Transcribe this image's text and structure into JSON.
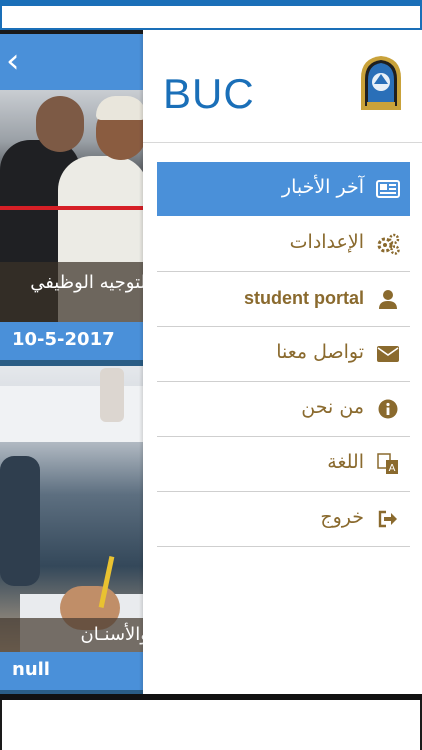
{
  "drawer": {
    "brand": "BUC",
    "menu": [
      {
        "label": "آخر الأخبار",
        "icon": "newspaper-icon",
        "active": true
      },
      {
        "label": "الإعدادات",
        "icon": "gears-icon",
        "active": false
      },
      {
        "label": "student portal",
        "icon": "user-icon",
        "active": false
      },
      {
        "label": "تواصل معنا",
        "icon": "envelope-icon",
        "active": false
      },
      {
        "label": "من نحن",
        "icon": "info-icon",
        "active": false
      },
      {
        "label": "اللغة",
        "icon": "translate-icon",
        "active": false
      },
      {
        "label": "خروج",
        "icon": "sign-out-icon",
        "active": false
      }
    ]
  },
  "feed": {
    "items": [
      {
        "caption": "التوجيه الوظيفي",
        "date": "10-5-2017"
      },
      {
        "caption": "والأسنـان",
        "date": "null"
      }
    ]
  },
  "colors": {
    "accent": "#4a90d9",
    "brand_blue": "#1a6fb8",
    "label_gold": "#8a6a2e"
  }
}
